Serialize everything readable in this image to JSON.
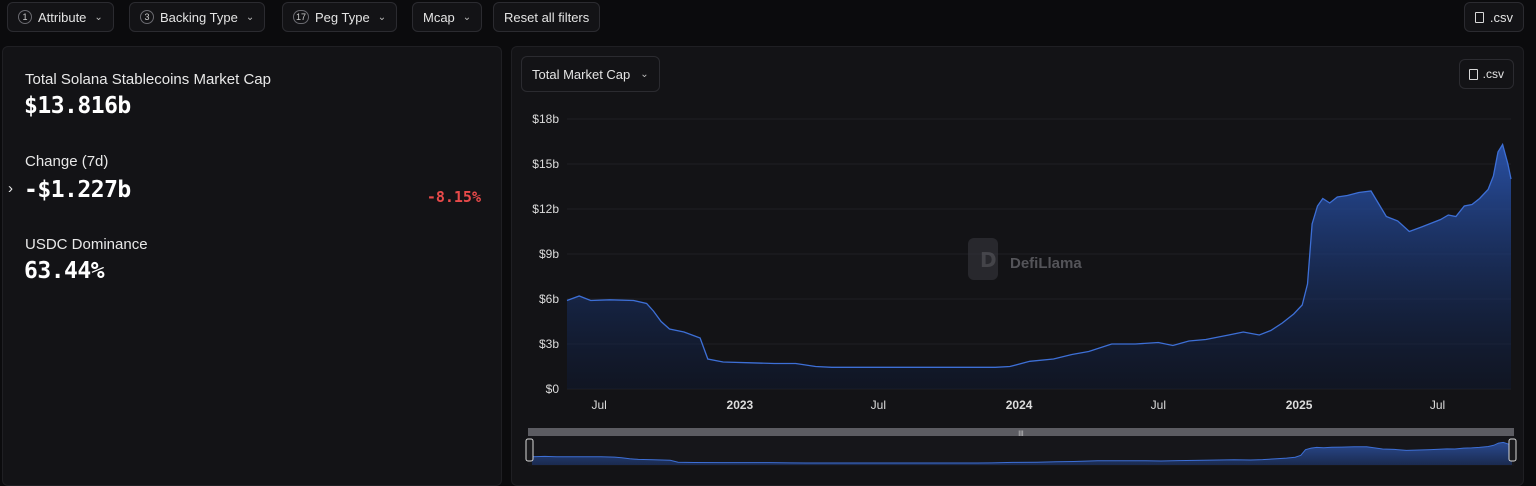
{
  "filters": {
    "attribute": {
      "count": "1",
      "label": "Attribute"
    },
    "backing_type": {
      "count": "3",
      "label": "Backing Type"
    },
    "peg_type": {
      "count": "17",
      "label": "Peg Type"
    },
    "mcap": {
      "label": "Mcap"
    },
    "reset": {
      "label": "Reset all filters"
    },
    "csv": {
      "label": ".csv"
    }
  },
  "stats": {
    "market_cap_label": "Total Solana Stablecoins Market Cap",
    "market_cap_value": "$13.816b",
    "change_label": "Change (7d)",
    "change_value": "-$1.227b",
    "change_pct": "-8.15%",
    "dominance_label": "USDC Dominance",
    "dominance_value": "63.44%"
  },
  "chart_panel": {
    "metric_select": "Total Market Cap",
    "csv_label": ".csv",
    "watermark": "DefiLlama"
  },
  "colors": {
    "accent": "#3d6fd6",
    "negative": "#e84a4a",
    "background": "#0b0b0d",
    "panel": "#131316"
  },
  "chart_data": {
    "type": "area",
    "title": "",
    "xlabel": "",
    "ylabel": "",
    "y_ticks": [
      "$0",
      "$3b",
      "$6b",
      "$9b",
      "$12b",
      "$15b",
      "$18b"
    ],
    "ylim": [
      0,
      18
    ],
    "y_unit": "billion USD",
    "x_ticks": [
      {
        "label": "Jul",
        "date": "2022-07-01",
        "bold": false
      },
      {
        "label": "2023",
        "date": "2023-01-01",
        "bold": true
      },
      {
        "label": "Jul",
        "date": "2023-07-01",
        "bold": false
      },
      {
        "label": "2024",
        "date": "2024-01-01",
        "bold": true
      },
      {
        "label": "Jul",
        "date": "2024-07-01",
        "bold": false
      },
      {
        "label": "2025",
        "date": "2025-01-01",
        "bold": true
      },
      {
        "label": "Jul",
        "date": "2025-07-01",
        "bold": false
      }
    ],
    "xlim": [
      "2022-05-20",
      "2025-10-05"
    ],
    "grid": true,
    "series": [
      {
        "x": [
          "2022-05-20",
          "2022-06-05",
          "2022-06-20",
          "2022-07-15",
          "2022-08-15",
          "2022-09-01",
          "2022-09-10",
          "2022-09-20",
          "2022-10-01",
          "2022-10-20",
          "2022-11-10",
          "2022-11-20",
          "2022-12-10",
          "2023-01-15",
          "2023-02-15",
          "2023-03-15",
          "2023-04-10",
          "2023-05-01",
          "2023-06-01",
          "2023-07-01",
          "2023-08-01",
          "2023-09-01",
          "2023-10-01",
          "2023-11-01",
          "2023-12-01",
          "2023-12-20",
          "2024-01-15",
          "2024-02-15",
          "2024-03-10",
          "2024-04-01",
          "2024-05-01",
          "2024-06-01",
          "2024-07-01",
          "2024-07-20",
          "2024-08-10",
          "2024-09-01",
          "2024-10-01",
          "2024-10-20",
          "2024-11-10",
          "2024-11-25",
          "2024-12-10",
          "2024-12-25",
          "2025-01-05",
          "2025-01-12",
          "2025-01-18",
          "2025-01-25",
          "2025-02-01",
          "2025-02-10",
          "2025-02-20",
          "2025-03-05",
          "2025-03-20",
          "2025-04-05",
          "2025-04-25",
          "2025-05-10",
          "2025-05-25",
          "2025-06-10",
          "2025-06-25",
          "2025-07-05",
          "2025-07-15",
          "2025-07-25",
          "2025-08-05",
          "2025-08-15",
          "2025-08-25",
          "2025-09-05",
          "2025-09-12",
          "2025-09-18",
          "2025-09-24",
          "2025-10-01",
          "2025-10-05"
        ],
        "values": [
          5.9,
          6.2,
          5.9,
          5.95,
          5.9,
          5.7,
          5.2,
          4.5,
          4.0,
          3.8,
          3.4,
          2.0,
          1.8,
          1.75,
          1.7,
          1.7,
          1.5,
          1.45,
          1.45,
          1.45,
          1.45,
          1.45,
          1.45,
          1.45,
          1.45,
          1.5,
          1.85,
          2.0,
          2.3,
          2.5,
          3.0,
          3.0,
          3.1,
          2.9,
          3.2,
          3.3,
          3.6,
          3.8,
          3.6,
          3.9,
          4.4,
          5.0,
          5.6,
          7.0,
          11.0,
          12.2,
          12.7,
          12.4,
          12.8,
          12.9,
          13.1,
          13.2,
          11.5,
          11.2,
          10.5,
          10.8,
          11.1,
          11.3,
          11.6,
          11.5,
          12.2,
          12.3,
          12.7,
          13.3,
          14.2,
          15.8,
          16.3,
          15.0,
          14.0
        ]
      }
    ]
  }
}
